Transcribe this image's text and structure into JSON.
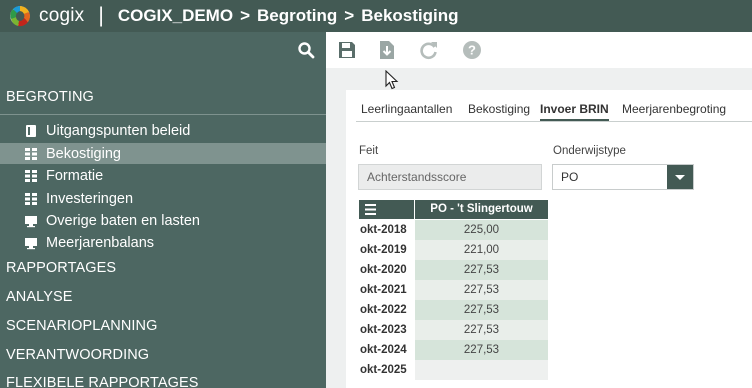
{
  "header": {
    "logo_text": "cogix",
    "separator": "|",
    "breadcrumbs": [
      "COGIX_DEMO",
      "Begroting",
      "Bekostiging"
    ],
    "crumb_separator": ">"
  },
  "sidebar": {
    "search_icon": "search-icon",
    "sections": {
      "begroting": "BEGROTING",
      "rapportages": "RAPPORTAGES",
      "analyse": "ANALYSE",
      "scenarioplanning": "SCENARIOPLANNING",
      "verantwoording": "VERANTWOORDING",
      "flexibele": "FLEXIBELE RAPPORTAGES"
    },
    "items": [
      {
        "label": "Uitgangspunten beleid",
        "icon": "book-icon"
      },
      {
        "label": "Bekostiging",
        "icon": "grid-icon",
        "active": true
      },
      {
        "label": "Formatie",
        "icon": "grid-icon"
      },
      {
        "label": "Investeringen",
        "icon": "grid-icon"
      },
      {
        "label": "Overige baten en lasten",
        "icon": "monitor-icon"
      },
      {
        "label": "Meerjarenbalans",
        "icon": "monitor-icon"
      }
    ]
  },
  "toolbar": {
    "icons": [
      "save-icon",
      "download-icon",
      "refresh-icon",
      "help-icon"
    ]
  },
  "tabs": [
    {
      "label": "Leerlingaantallen"
    },
    {
      "label": "Bekostiging"
    },
    {
      "label": "Invoer BRIN",
      "active": true
    },
    {
      "label": "Meerjarenbegroting"
    }
  ],
  "form": {
    "feit_label": "Feit",
    "feit_value": "Achterstandsscore",
    "onderwijstype_label": "Onderwijstype",
    "onderwijstype_value": "PO"
  },
  "grid": {
    "column_header": "PO - 't Slingertouw",
    "rows": [
      {
        "label": "okt-2018",
        "value": "225,00"
      },
      {
        "label": "okt-2019",
        "value": "221,00"
      },
      {
        "label": "okt-2020",
        "value": "227,53"
      },
      {
        "label": "okt-2021",
        "value": "227,53"
      },
      {
        "label": "okt-2022",
        "value": "227,53"
      },
      {
        "label": "okt-2023",
        "value": "227,53"
      },
      {
        "label": "okt-2024",
        "value": "227,53"
      },
      {
        "label": "okt-2025",
        "value": ""
      }
    ]
  },
  "colors": {
    "header_bg": "#435a54",
    "sidebar_bg": "#4d6762",
    "sidebar_active": "#7f938f",
    "grid_cell_a": "#d6e4da",
    "grid_cell_b": "#e9eeea"
  }
}
